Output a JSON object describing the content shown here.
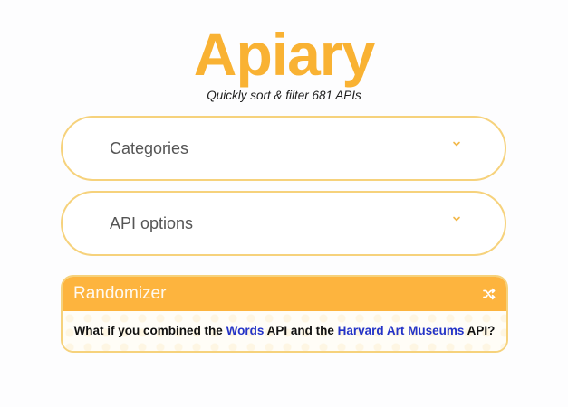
{
  "brand": {
    "logo": "Apiary",
    "tagline": "Quickly sort & filter 681 APIs",
    "accent_color": "#f9b233"
  },
  "filters": {
    "categories_label": "Categories",
    "api_options_label": "API options",
    "chevron_icon": "chevron-down-icon"
  },
  "randomizer": {
    "title": "Randomizer",
    "shuffle_icon": "shuffle-icon",
    "sentence": {
      "prefix": "What if you combined the",
      "api1": "Words",
      "middle": "API and the",
      "api2": "Harvard Art Museums",
      "suffix": "API?"
    },
    "link_color": "#2433c7",
    "header_color": "#fdb43e"
  }
}
